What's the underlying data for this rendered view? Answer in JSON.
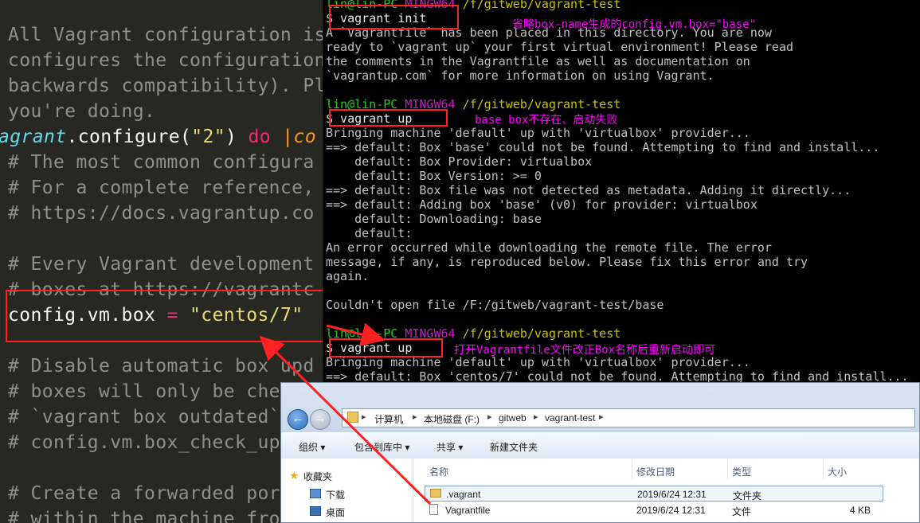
{
  "editor": {
    "lines": [
      "All Vagrant configuration is",
      "configures the configuration",
      "backwards compatibility). Pl",
      "you're doing."
    ],
    "configure_line": {
      "cls": "agrant",
      "dot": ".configure(",
      "str": "\"2\"",
      "close": ") ",
      "kw": "do",
      "bar": " |co"
    },
    "comments": [
      "# The most common configura",
      "# For a complete reference,",
      "# https://docs.vagrantup.co",
      "",
      "# Every Vagrant development",
      "# boxes at https://vagrantc"
    ],
    "box_line": {
      "prefix": "config.vm.box ",
      "eq": "=",
      "value": "\"centos/7\""
    },
    "comments2": [
      "# Disable automatic box upd",
      "# boxes will only be checke",
      "# `vagrant box outdated`. T",
      "# config.vm.box_check_updat",
      "",
      "# Create a forwarded port m",
      "# within the machine from a"
    ]
  },
  "terminal": {
    "prompt1": {
      "user": "lin@lin-PC",
      "env": "MINGW64",
      "path": "/f/gitweb/vagrant-test"
    },
    "cmd1": "$ vagrant init",
    "out1": [
      "A `Vagrantfile` has been placed in this directory. You are now",
      "ready to `vagrant up` your first virtual environment! Please read",
      "the comments in the Vagrantfile as well as documentation on",
      "`vagrantup.com` for more information on using Vagrant."
    ],
    "prompt2": {
      "user": "lin@lin-PC",
      "env": "MINGW64",
      "path": "/f/gitweb/vagrant-test"
    },
    "cmd2": "$ vagrant up",
    "out2": [
      "Bringing machine 'default' up with 'virtualbox' provider...",
      "==> default: Box 'base' could not be found. Attempting to find and install...",
      "    default: Box Provider: virtualbox",
      "    default: Box Version: >= 0",
      "==> default: Box file was not detected as metadata. Adding it directly...",
      "==> default: Adding box 'base' (v0) for provider: virtualbox",
      "    default: Downloading: base",
      "    default:",
      "An error occurred while downloading the remote file. The error",
      "message, if any, is reproduced below. Please fix this error and try",
      "again.",
      "",
      "Couldn't open file /F:/gitweb/vagrant-test/base"
    ],
    "prompt3": {
      "user": "lin@lin-PC",
      "env": "MINGW64",
      "path": "/f/gitweb/vagrant-test"
    },
    "cmd3": "$ vagrant up",
    "out3": [
      "Bringing machine 'default' up with 'virtualbox' provider...",
      "==> default: Box 'centos/7' could not be found. Attempting to find and install..."
    ]
  },
  "annotations": {
    "a1": "省略box-name生成的config.vm.box=\"base\"",
    "a2": "base box不存在、启动失败",
    "a3": "打开Vagrantfile文件改正Box名称后重新启动即可"
  },
  "explorer": {
    "breadcrumb": [
      "计算机",
      "本地磁盘 (F:)",
      "gitweb",
      "vagrant-test"
    ],
    "toolbar": [
      "组织 ▾",
      "包含到库中 ▾",
      "共享 ▾",
      "新建文件夹"
    ],
    "nav": [
      "收藏夹",
      "下载",
      "桌面"
    ],
    "columns": [
      "名称",
      "修改日期",
      "类型",
      "大小"
    ],
    "files": [
      {
        "name": ".vagrant",
        "date": "2019/6/24 12:31",
        "type": "文件夹",
        "size": ""
      },
      {
        "name": "Vagrantfile",
        "date": "2019/6/24 12:31",
        "type": "文件",
        "size": "4 KB"
      }
    ]
  },
  "colors": {
    "highlight": "#ff2020",
    "annotation": "#ff00ff",
    "prompt_green": "#1fd11f",
    "prompt_purple": "#c020c0",
    "prompt_yellow": "#c8c000"
  }
}
